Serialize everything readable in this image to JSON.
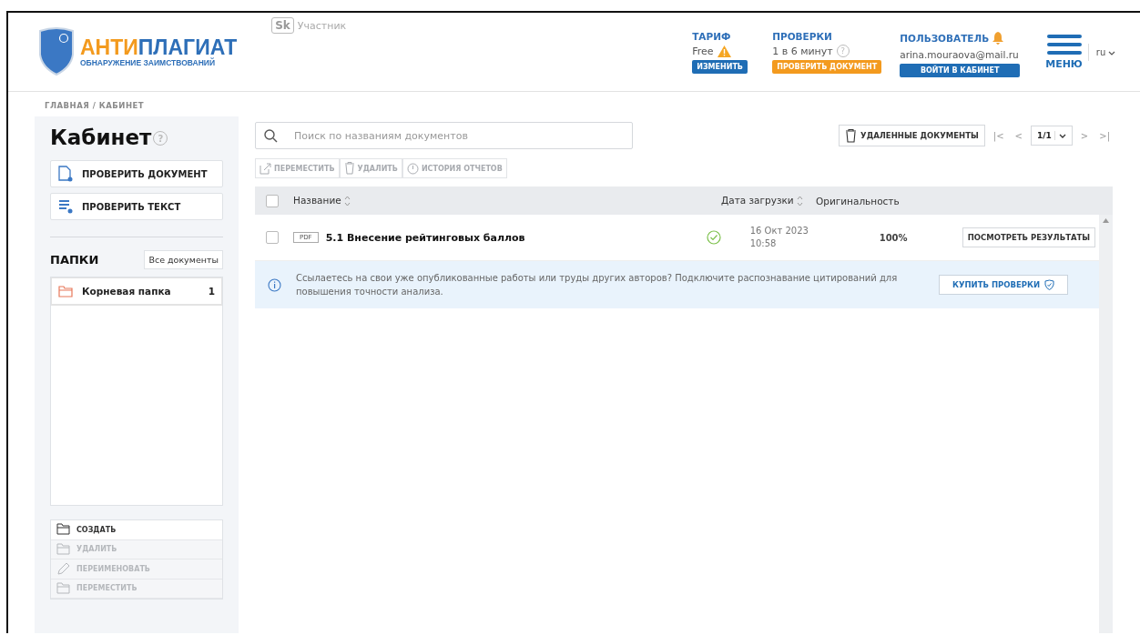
{
  "header": {
    "logo": {
      "title_accent": "АНТИ",
      "title_rest": "ПЛАГИАТ",
      "subtitle": "ОБНАРУЖЕНИЕ ЗАИМСТВОВАНИЙ"
    },
    "sk_badge": "Sk",
    "sk_label": "Участник",
    "tariff": {
      "label": "ТАРИФ",
      "value": "Free",
      "warning": true,
      "button": "ИЗМЕНИТЬ"
    },
    "checks": {
      "label": "ПРОВЕРКИ",
      "value": "1 в 6 минут",
      "help": "?",
      "button": "ПРОВЕРИТЬ ДОКУМЕНТ"
    },
    "user": {
      "label": "ПОЛЬЗОВАТЕЛЬ",
      "notification": true,
      "email": "arina.mouraova@mail.ru",
      "button": "ВОЙТИ В КАБИНЕТ"
    },
    "menu": "МЕНЮ",
    "language": "ru"
  },
  "breadcrumb": "ГЛАВНАЯ / КАБИНЕТ",
  "sidebar": {
    "title": "Кабинет",
    "help": "?",
    "actions": [
      {
        "kind": "document",
        "label": "ПРОВЕРИТЬ ДОКУМЕНТ"
      },
      {
        "kind": "text",
        "label": "ПРОВЕРИТЬ ТЕКСТ"
      }
    ],
    "folders_title": "ПАПКИ",
    "all_documents": "Все документы",
    "folders": [
      {
        "name": "Корневая папка",
        "count": "1",
        "selected": true
      }
    ],
    "folder_actions": [
      {
        "kind": "create",
        "label": "СОЗДАТЬ",
        "disabled": false
      },
      {
        "kind": "delete",
        "label": "УДАЛИТЬ",
        "disabled": true
      },
      {
        "kind": "rename",
        "label": "ПЕРЕИМЕНОВАТЬ",
        "disabled": true
      },
      {
        "kind": "move",
        "label": "ПЕРЕМЕСТИТЬ",
        "disabled": true
      }
    ]
  },
  "search": {
    "placeholder": "Поиск по названиям документов"
  },
  "deleted_documents": "УДАЛЕННЫЕ ДОКУМЕНТЫ",
  "pagination": {
    "first": "|<",
    "prev": "<",
    "page": "1/1",
    "next": ">",
    "last": ">|"
  },
  "toolbar": [
    {
      "kind": "move",
      "label": "ПЕРЕМЕСТИТЬ",
      "disabled": true
    },
    {
      "kind": "delete",
      "label": "УДАЛИТЬ",
      "disabled": true
    },
    {
      "kind": "history",
      "label": "ИСТОРИЯ ОТЧЕТОВ",
      "disabled": true
    }
  ],
  "table": {
    "all_checked": false,
    "columns": [
      "Название",
      "Дата загрузки",
      "Оригинальность"
    ],
    "rows": [
      {
        "checked": false,
        "type": "PDF",
        "name": "5.1 Внесение рейтинговых баллов",
        "done": true,
        "date": "16 Окт 2023",
        "time": "10:58",
        "originality": "100%",
        "action": "ПОСМОТРЕТЬ РЕЗУЛЬТАТЫ"
      }
    ]
  },
  "notice": {
    "text": "Ссылаетесь на свои уже опубликованные работы или труды других авторов? Подключите распознавание цитирований для повышения точности анализа.",
    "button": "КУПИТЬ ПРОВЕРКИ"
  }
}
